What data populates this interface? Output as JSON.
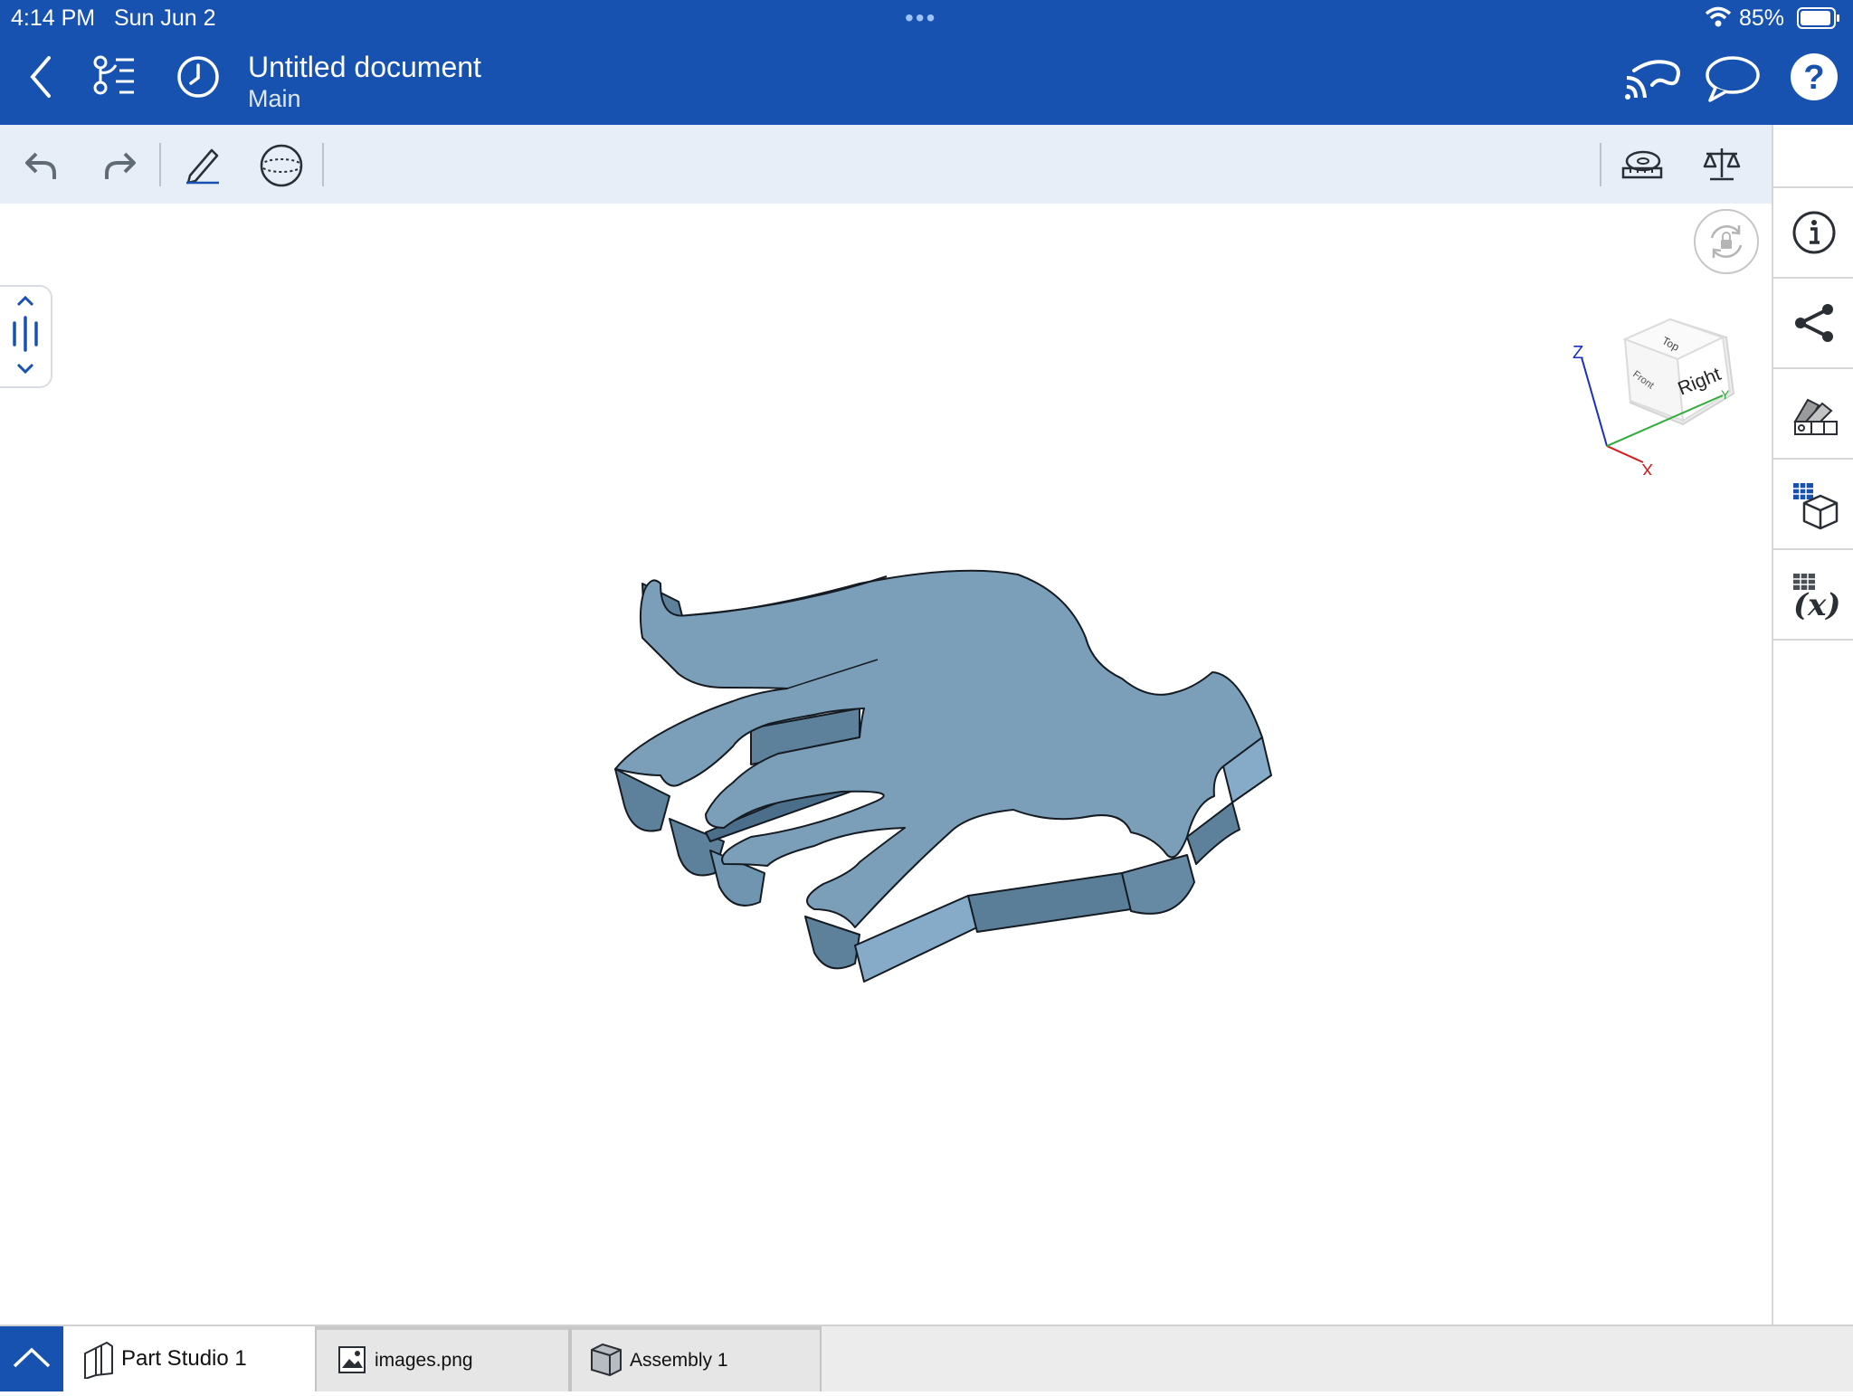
{
  "status_bar": {
    "time": "4:14 PM",
    "date": "Sun Jun 2",
    "battery": "85%"
  },
  "header": {
    "title": "Untitled document",
    "subtitle": "Main"
  },
  "view_cube": {
    "top": "Top",
    "right": "Right",
    "front": "Front",
    "axis_z": "Z",
    "axis_x": "X",
    "axis_y": "Y"
  },
  "tabs": [
    {
      "label": "Part Studio 1",
      "icon": "part-studio-icon",
      "active": true
    },
    {
      "label": "images.png",
      "icon": "image-icon",
      "active": false
    },
    {
      "label": "Assembly 1",
      "icon": "assembly-icon",
      "active": false
    }
  ],
  "colors": {
    "header": "#1752b0",
    "toolbar": "#e7eef8",
    "model_top": "#7b9fb9",
    "model_side": "#5e819b"
  }
}
